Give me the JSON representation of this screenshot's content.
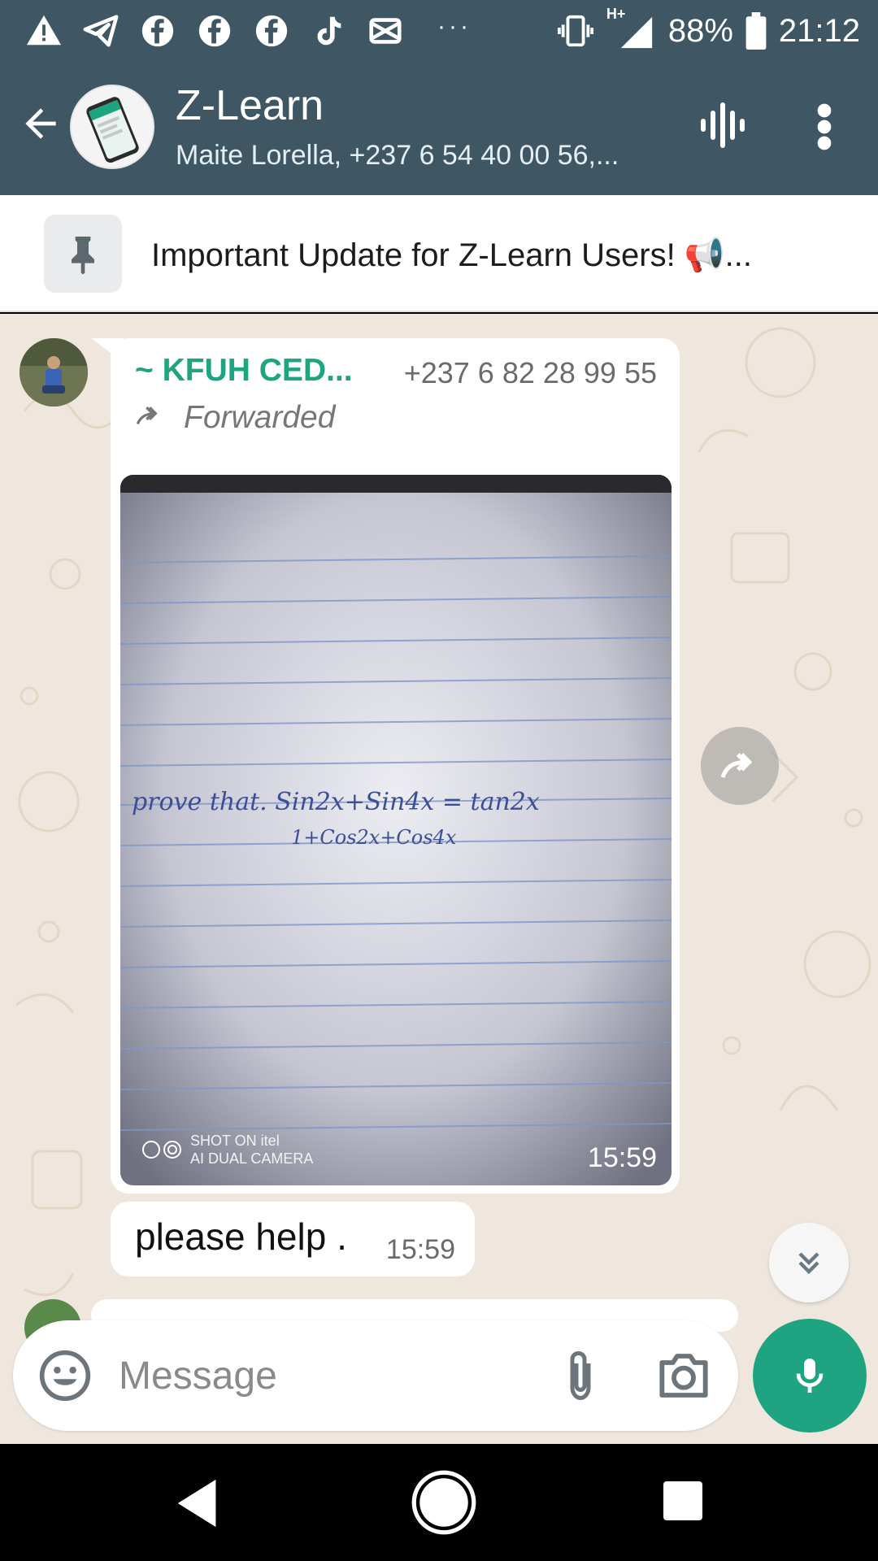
{
  "status_bar": {
    "battery": "88%",
    "time": "21:12",
    "network": "H+",
    "overflow": "···",
    "icons": [
      "warning-icon",
      "telegram-icon",
      "facebook-icon",
      "facebook-icon",
      "facebook-icon",
      "tiktok-icon",
      "capcut-icon",
      "vibrate-icon",
      "signal-icon",
      "battery-icon"
    ]
  },
  "header": {
    "title": "Z-Learn",
    "subtitle": "Maite Lorella, +237 6 54 40 00 56,..."
  },
  "pinned": {
    "text": "Important Update for Z-Learn Users! 📢..."
  },
  "messages": [
    {
      "sender_name": "~ KFUH CED...",
      "sender_phone": "+237 6 82 28 99 55",
      "forwarded_label": "Forwarded",
      "photo_time": "15:59",
      "photo_handwriting": "prove that. Sin2x+Sin4x = tan2x",
      "photo_handwriting_2": "1+Cos2x+Cos4x",
      "watermark_line1": "SHOT ON itel",
      "watermark_line2": "AI DUAL CAMERA"
    },
    {
      "text": "please help .",
      "time": "15:59"
    }
  ],
  "composer": {
    "placeholder": "Message"
  },
  "colors": {
    "header": "#3f5764",
    "accent": "#1ea480",
    "chat_bg": "#efe7de"
  }
}
